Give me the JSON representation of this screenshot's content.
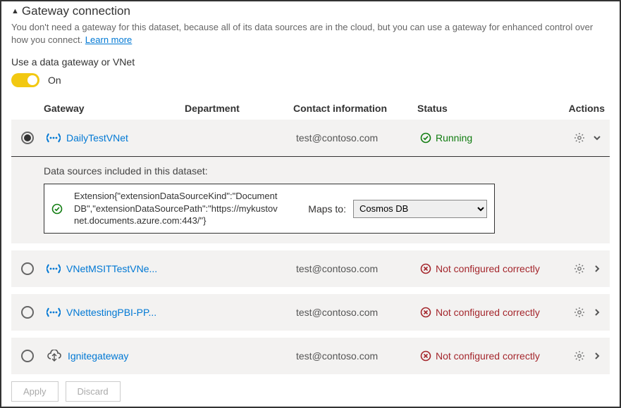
{
  "header": {
    "title": "Gateway connection",
    "hint_text": "You don't need a gateway for this dataset, because all of its data sources are in the cloud, but you can use a gateway for enhanced control over how you connect. ",
    "learn_more": "Learn more"
  },
  "toggle": {
    "label": "Use a data gateway or VNet",
    "state_label": "On",
    "on": true
  },
  "columns": {
    "gateway": "Gateway",
    "department": "Department",
    "contact": "Contact information",
    "status": "Status",
    "actions": "Actions"
  },
  "gateways": [
    {
      "selected": true,
      "icon": "vnet",
      "name": "DailyTestVNet",
      "department": "",
      "contact": "test@contoso.com",
      "status_kind": "ok",
      "status_text": "Running",
      "expanded": true
    },
    {
      "selected": false,
      "icon": "vnet",
      "name": "VNetMSITTestVNe...",
      "department": "",
      "contact": "test@contoso.com",
      "status_kind": "err",
      "status_text": "Not configured correctly",
      "expanded": false
    },
    {
      "selected": false,
      "icon": "vnet",
      "name": "VNettestingPBI-PP...",
      "department": "",
      "contact": "test@contoso.com",
      "status_kind": "err",
      "status_text": "Not configured correctly",
      "expanded": false
    },
    {
      "selected": false,
      "icon": "cloud",
      "name": "Ignitegateway",
      "department": "",
      "contact": "test@contoso.com",
      "status_kind": "err",
      "status_text": "Not configured correctly",
      "expanded": false
    }
  ],
  "datasource_panel": {
    "caption": "Data sources included in this dataset:",
    "ds_text": "Extension{\"extensionDataSourceKind\":\"DocumentDB\",\"extensionDataSourcePath\":\"https://mykustovnet.documents.azure.com:443/\"}",
    "maps_to_label": "Maps to:",
    "selected_option": "Cosmos DB"
  },
  "footer": {
    "apply": "Apply",
    "discard": "Discard"
  }
}
